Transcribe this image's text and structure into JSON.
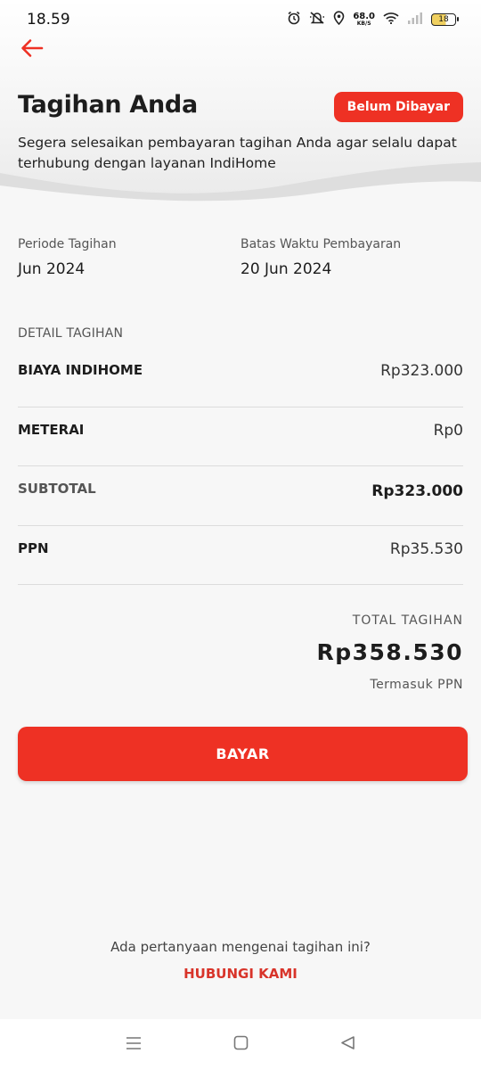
{
  "status_bar": {
    "time": "18.59",
    "net_speed": "68.0",
    "net_unit": "KB/S",
    "battery": "18"
  },
  "header": {
    "title": "Tagihan Anda",
    "badge": "Belum Dibayar",
    "description": "Segera selesaikan pembayaran tagihan Anda agar selalu dapat terhubung dengan layanan IndiHome"
  },
  "period": {
    "billing_label": "Periode Tagihan",
    "billing_value": "Jun 2024",
    "due_label": "Batas Waktu Pembayaran",
    "due_value": "20 Jun 2024"
  },
  "detail": {
    "heading": "DETAIL TAGIHAN",
    "rows": [
      {
        "label": "BIAYA INDIHOME",
        "value": "Rp323.000"
      },
      {
        "label": "METERAI",
        "value": "Rp0"
      },
      {
        "label": "SUBTOTAL",
        "value": "Rp323.000"
      },
      {
        "label": "PPN",
        "value": "Rp35.530"
      }
    ]
  },
  "total": {
    "label": "TOTAL TAGIHAN",
    "amount": "Rp358.530",
    "note": "Termasuk PPN"
  },
  "actions": {
    "pay_label": "BAYAR"
  },
  "footer": {
    "question": "Ada pertanyaan mengenai tagihan ini?",
    "contact_label": "HUBUNGI KAMI"
  },
  "colors": {
    "accent": "#ee3124",
    "background": "#f7f7f7"
  },
  "icons": {
    "back": "arrow-left-icon",
    "alarm": "alarm-icon",
    "mute": "bell-off-icon",
    "location": "location-pin-icon",
    "wifi": "wifi-icon",
    "signal": "signal-icon",
    "battery": "battery-icon"
  }
}
